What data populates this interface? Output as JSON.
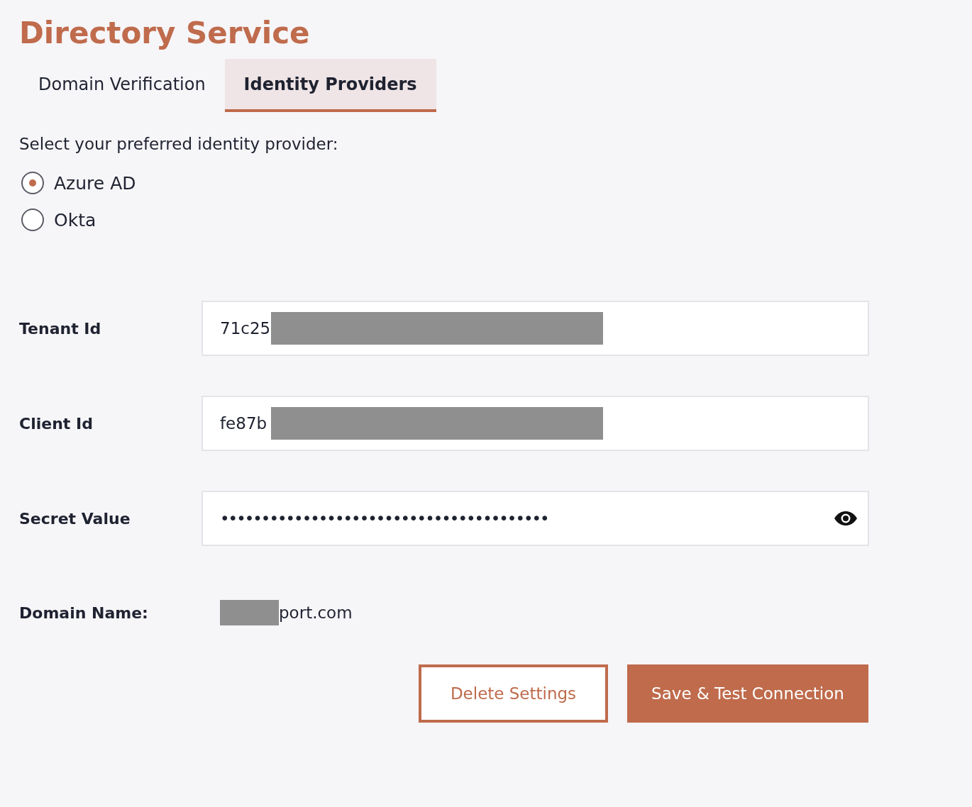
{
  "title": "Directory Service",
  "tabs": [
    {
      "label": "Domain Verification",
      "selected": false
    },
    {
      "label": "Identity Providers",
      "selected": true
    }
  ],
  "provider_prompt": "Select your preferred identity provider:",
  "providers": [
    {
      "label": "Azure AD",
      "selected": true
    },
    {
      "label": "Okta",
      "selected": false
    }
  ],
  "fields": [
    {
      "label": "Tenant Id",
      "value": "71c25",
      "redacted": true,
      "kind": "text"
    },
    {
      "label": "Client Id",
      "value": "fe87b",
      "redacted": true,
      "kind": "text"
    },
    {
      "label": "Secret Value",
      "value": "••••••••••••••••••••••••••••••••••••••••",
      "redacted": false,
      "kind": "secret"
    }
  ],
  "domain": {
    "label": "Domain Name:",
    "value": "port.com",
    "redacted": true
  },
  "buttons": [
    {
      "label": "Delete Settings",
      "kind": "outline"
    },
    {
      "label": "Save & Test Connection",
      "kind": "primary"
    }
  ]
}
